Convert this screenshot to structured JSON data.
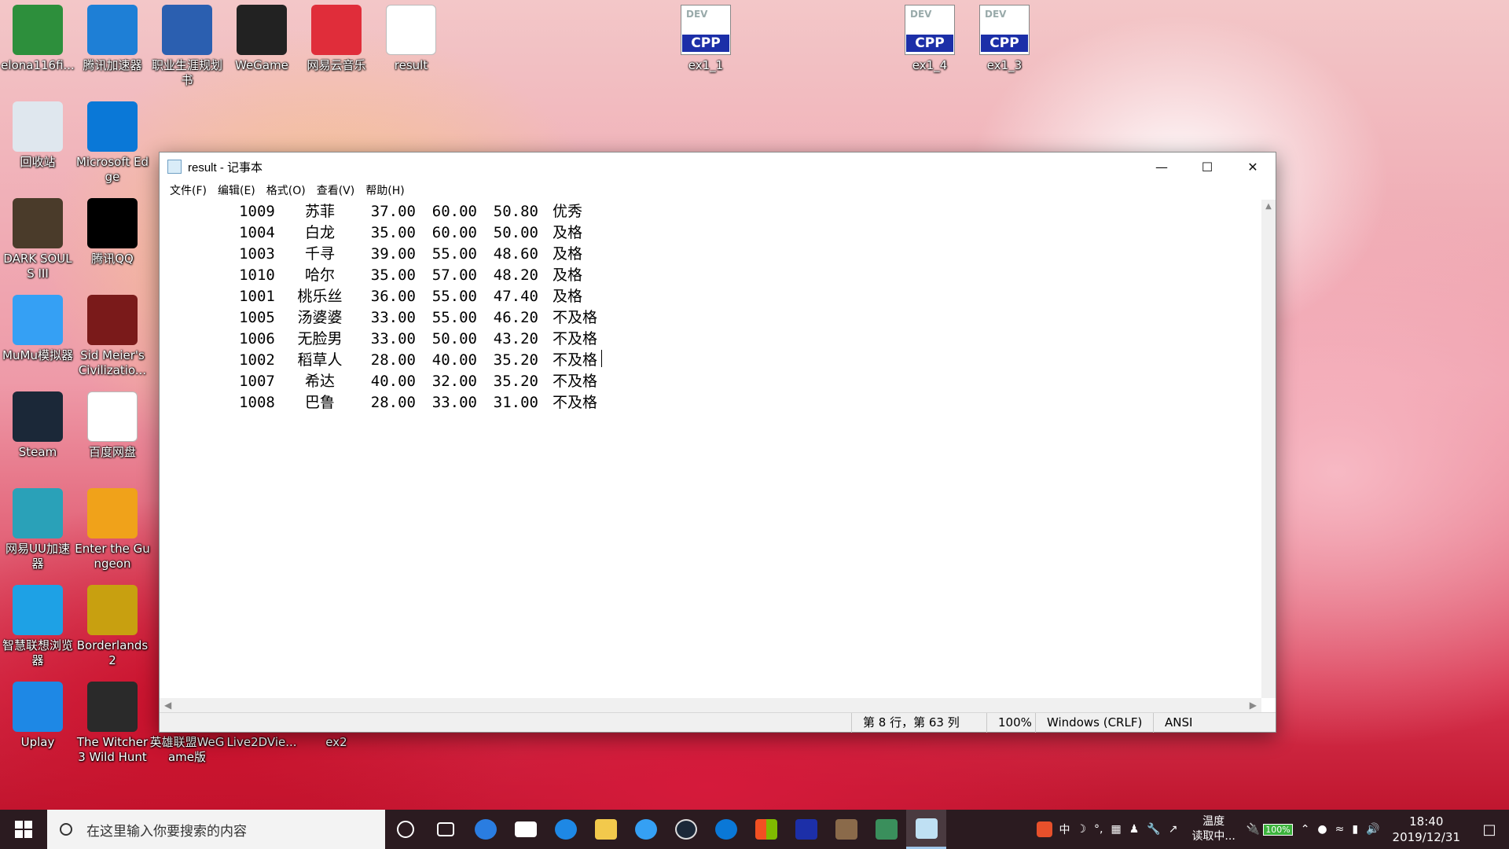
{
  "desktop_icons": [
    {
      "label": "elona116fi...",
      "name": "elona-icon"
    },
    {
      "label": "腾讯加速器",
      "name": "tencent-accelerator-icon"
    },
    {
      "label": "职业生涯规划书",
      "name": "word-doc-icon"
    },
    {
      "label": "WeGame",
      "name": "wegame-icon"
    },
    {
      "label": "网易云音乐",
      "name": "netease-music-icon"
    },
    {
      "label": "result",
      "name": "text-file-icon"
    },
    {
      "label": "ex1_1",
      "name": "cpp-file-icon"
    },
    {
      "label": "ex1_4",
      "name": "cpp-file-icon"
    },
    {
      "label": "ex1_3",
      "name": "cpp-file-icon"
    },
    {
      "label": "回收站",
      "name": "recycle-bin-icon"
    },
    {
      "label": "Microsoft Edge",
      "name": "edge-icon"
    },
    {
      "label": "DARK SOULS III",
      "name": "dark-souls-icon"
    },
    {
      "label": "腾讯QQ",
      "name": "qq-icon"
    },
    {
      "label": "MuMu模拟器",
      "name": "mumu-icon"
    },
    {
      "label": "Sid Meier's Civilizatio...",
      "name": "civilization-icon"
    },
    {
      "label": "Steam",
      "name": "steam-icon"
    },
    {
      "label": "百度网盘",
      "name": "baidu-netdisk-icon"
    },
    {
      "label": "网易UU加速器",
      "name": "uu-accelerator-icon"
    },
    {
      "label": "Enter the Gungeon",
      "name": "gungeon-icon"
    },
    {
      "label": "智慧联想浏览器",
      "name": "lenovo-browser-icon"
    },
    {
      "label": "Borderlands 2",
      "name": "borderlands-icon"
    },
    {
      "label": "Uplay",
      "name": "uplay-icon"
    },
    {
      "label": "The Witcher 3 Wild Hunt",
      "name": "witcher-icon"
    },
    {
      "label": "英雄联盟WeGame版",
      "name": "lol-wegame-icon"
    },
    {
      "label": "Live2DVie...",
      "name": "live2d-icon"
    },
    {
      "label": "ex2",
      "name": "word-doc-icon"
    }
  ],
  "cpp_tag": "CPP",
  "dev_tag": "DEV",
  "notepad": {
    "title": "result - 记事本",
    "menu": [
      "文件(F)",
      "编辑(E)",
      "格式(O)",
      "查看(V)",
      "帮助(H)"
    ],
    "rows": [
      [
        "1009",
        "苏菲",
        "37.00",
        "60.00",
        "50.80",
        "优秀"
      ],
      [
        "1004",
        "白龙",
        "35.00",
        "60.00",
        "50.00",
        "及格"
      ],
      [
        "1003",
        "千寻",
        "39.00",
        "55.00",
        "48.60",
        "及格"
      ],
      [
        "1010",
        "哈尔",
        "35.00",
        "57.00",
        "48.20",
        "及格"
      ],
      [
        "1001",
        "桃乐丝",
        "36.00",
        "55.00",
        "47.40",
        "及格"
      ],
      [
        "1005",
        "汤婆婆",
        "33.00",
        "55.00",
        "46.20",
        "不及格"
      ],
      [
        "1006",
        "无脸男",
        "33.00",
        "50.00",
        "43.20",
        "不及格"
      ],
      [
        "1002",
        "稻草人",
        "28.00",
        "40.00",
        "35.20",
        "不及格"
      ],
      [
        "1007",
        "希达",
        "40.00",
        "32.00",
        "35.20",
        "不及格"
      ],
      [
        "1008",
        "巴鲁",
        "28.00",
        "33.00",
        "31.00",
        "不及格"
      ]
    ],
    "status": {
      "position": "第 8 行，第 63 列",
      "zoom": "100%",
      "line_ending": "Windows (CRLF)",
      "encoding": "ANSI"
    }
  },
  "taskbar": {
    "search_placeholder": "在这里输入你要搜索的内容",
    "temperature_label": "温度",
    "temperature_value": "读取中...",
    "battery": "100%",
    "ime": "中",
    "time": "18:40",
    "date": "2019/12/31"
  }
}
